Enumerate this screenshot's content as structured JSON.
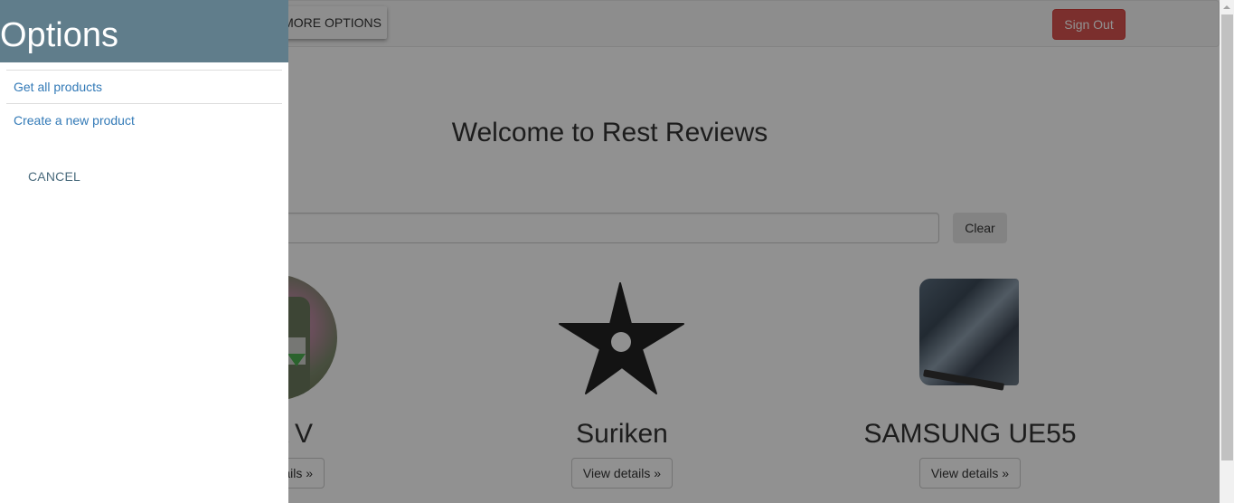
{
  "navbar": {
    "more_options_label": "MORE OPTIONS",
    "sign_out_label": "Sign Out",
    "sign_out_color": "#d9534f"
  },
  "main": {
    "welcome_title": "Welcome to Rest Reviews",
    "search": {
      "value": "",
      "placeholder": ""
    },
    "clear_label": "Clear",
    "products": [
      {
        "name": "GTA V",
        "visible_name": "V",
        "image": "gta-v-cover-image",
        "view_label": "View details »",
        "visible_view_label": "ils »"
      },
      {
        "name": "Suriken",
        "image": "shuriken-icon",
        "view_label": "View details »"
      },
      {
        "name": "SAMSUNG UE55",
        "image": "samsung-tv-image",
        "view_label": "View details »"
      }
    ]
  },
  "side_panel": {
    "title": "Options",
    "header_color": "#607d8b",
    "items": [
      {
        "label": "Get all products"
      },
      {
        "label": "Create a new product"
      }
    ],
    "cancel_label": "CANCEL"
  }
}
